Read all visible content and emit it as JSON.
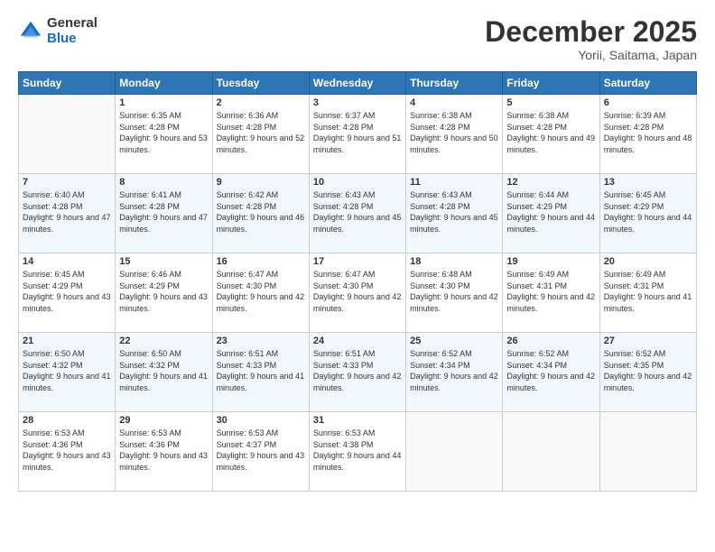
{
  "header": {
    "logo_general": "General",
    "logo_blue": "Blue",
    "month_title": "December 2025",
    "location": "Yorii, Saitama, Japan"
  },
  "weekdays": [
    "Sunday",
    "Monday",
    "Tuesday",
    "Wednesday",
    "Thursday",
    "Friday",
    "Saturday"
  ],
  "weeks": [
    [
      {
        "day": "",
        "sunrise": "",
        "sunset": "",
        "daylight": ""
      },
      {
        "day": "1",
        "sunrise": "Sunrise: 6:35 AM",
        "sunset": "Sunset: 4:28 PM",
        "daylight": "Daylight: 9 hours and 53 minutes."
      },
      {
        "day": "2",
        "sunrise": "Sunrise: 6:36 AM",
        "sunset": "Sunset: 4:28 PM",
        "daylight": "Daylight: 9 hours and 52 minutes."
      },
      {
        "day": "3",
        "sunrise": "Sunrise: 6:37 AM",
        "sunset": "Sunset: 4:28 PM",
        "daylight": "Daylight: 9 hours and 51 minutes."
      },
      {
        "day": "4",
        "sunrise": "Sunrise: 6:38 AM",
        "sunset": "Sunset: 4:28 PM",
        "daylight": "Daylight: 9 hours and 50 minutes."
      },
      {
        "day": "5",
        "sunrise": "Sunrise: 6:38 AM",
        "sunset": "Sunset: 4:28 PM",
        "daylight": "Daylight: 9 hours and 49 minutes."
      },
      {
        "day": "6",
        "sunrise": "Sunrise: 6:39 AM",
        "sunset": "Sunset: 4:28 PM",
        "daylight": "Daylight: 9 hours and 48 minutes."
      }
    ],
    [
      {
        "day": "7",
        "sunrise": "Sunrise: 6:40 AM",
        "sunset": "Sunset: 4:28 PM",
        "daylight": "Daylight: 9 hours and 47 minutes."
      },
      {
        "day": "8",
        "sunrise": "Sunrise: 6:41 AM",
        "sunset": "Sunset: 4:28 PM",
        "daylight": "Daylight: 9 hours and 47 minutes."
      },
      {
        "day": "9",
        "sunrise": "Sunrise: 6:42 AM",
        "sunset": "Sunset: 4:28 PM",
        "daylight": "Daylight: 9 hours and 46 minutes."
      },
      {
        "day": "10",
        "sunrise": "Sunrise: 6:43 AM",
        "sunset": "Sunset: 4:28 PM",
        "daylight": "Daylight: 9 hours and 45 minutes."
      },
      {
        "day": "11",
        "sunrise": "Sunrise: 6:43 AM",
        "sunset": "Sunset: 4:28 PM",
        "daylight": "Daylight: 9 hours and 45 minutes."
      },
      {
        "day": "12",
        "sunrise": "Sunrise: 6:44 AM",
        "sunset": "Sunset: 4:29 PM",
        "daylight": "Daylight: 9 hours and 44 minutes."
      },
      {
        "day": "13",
        "sunrise": "Sunrise: 6:45 AM",
        "sunset": "Sunset: 4:29 PM",
        "daylight": "Daylight: 9 hours and 44 minutes."
      }
    ],
    [
      {
        "day": "14",
        "sunrise": "Sunrise: 6:45 AM",
        "sunset": "Sunset: 4:29 PM",
        "daylight": "Daylight: 9 hours and 43 minutes."
      },
      {
        "day": "15",
        "sunrise": "Sunrise: 6:46 AM",
        "sunset": "Sunset: 4:29 PM",
        "daylight": "Daylight: 9 hours and 43 minutes."
      },
      {
        "day": "16",
        "sunrise": "Sunrise: 6:47 AM",
        "sunset": "Sunset: 4:30 PM",
        "daylight": "Daylight: 9 hours and 42 minutes."
      },
      {
        "day": "17",
        "sunrise": "Sunrise: 6:47 AM",
        "sunset": "Sunset: 4:30 PM",
        "daylight": "Daylight: 9 hours and 42 minutes."
      },
      {
        "day": "18",
        "sunrise": "Sunrise: 6:48 AM",
        "sunset": "Sunset: 4:30 PM",
        "daylight": "Daylight: 9 hours and 42 minutes."
      },
      {
        "day": "19",
        "sunrise": "Sunrise: 6:49 AM",
        "sunset": "Sunset: 4:31 PM",
        "daylight": "Daylight: 9 hours and 42 minutes."
      },
      {
        "day": "20",
        "sunrise": "Sunrise: 6:49 AM",
        "sunset": "Sunset: 4:31 PM",
        "daylight": "Daylight: 9 hours and 41 minutes."
      }
    ],
    [
      {
        "day": "21",
        "sunrise": "Sunrise: 6:50 AM",
        "sunset": "Sunset: 4:32 PM",
        "daylight": "Daylight: 9 hours and 41 minutes."
      },
      {
        "day": "22",
        "sunrise": "Sunrise: 6:50 AM",
        "sunset": "Sunset: 4:32 PM",
        "daylight": "Daylight: 9 hours and 41 minutes."
      },
      {
        "day": "23",
        "sunrise": "Sunrise: 6:51 AM",
        "sunset": "Sunset: 4:33 PM",
        "daylight": "Daylight: 9 hours and 41 minutes."
      },
      {
        "day": "24",
        "sunrise": "Sunrise: 6:51 AM",
        "sunset": "Sunset: 4:33 PM",
        "daylight": "Daylight: 9 hours and 42 minutes."
      },
      {
        "day": "25",
        "sunrise": "Sunrise: 6:52 AM",
        "sunset": "Sunset: 4:34 PM",
        "daylight": "Daylight: 9 hours and 42 minutes."
      },
      {
        "day": "26",
        "sunrise": "Sunrise: 6:52 AM",
        "sunset": "Sunset: 4:34 PM",
        "daylight": "Daylight: 9 hours and 42 minutes."
      },
      {
        "day": "27",
        "sunrise": "Sunrise: 6:52 AM",
        "sunset": "Sunset: 4:35 PM",
        "daylight": "Daylight: 9 hours and 42 minutes."
      }
    ],
    [
      {
        "day": "28",
        "sunrise": "Sunrise: 6:53 AM",
        "sunset": "Sunset: 4:36 PM",
        "daylight": "Daylight: 9 hours and 43 minutes."
      },
      {
        "day": "29",
        "sunrise": "Sunrise: 6:53 AM",
        "sunset": "Sunset: 4:36 PM",
        "daylight": "Daylight: 9 hours and 43 minutes."
      },
      {
        "day": "30",
        "sunrise": "Sunrise: 6:53 AM",
        "sunset": "Sunset: 4:37 PM",
        "daylight": "Daylight: 9 hours and 43 minutes."
      },
      {
        "day": "31",
        "sunrise": "Sunrise: 6:53 AM",
        "sunset": "Sunset: 4:38 PM",
        "daylight": "Daylight: 9 hours and 44 minutes."
      },
      {
        "day": "",
        "sunrise": "",
        "sunset": "",
        "daylight": ""
      },
      {
        "day": "",
        "sunrise": "",
        "sunset": "",
        "daylight": ""
      },
      {
        "day": "",
        "sunrise": "",
        "sunset": "",
        "daylight": ""
      }
    ]
  ]
}
